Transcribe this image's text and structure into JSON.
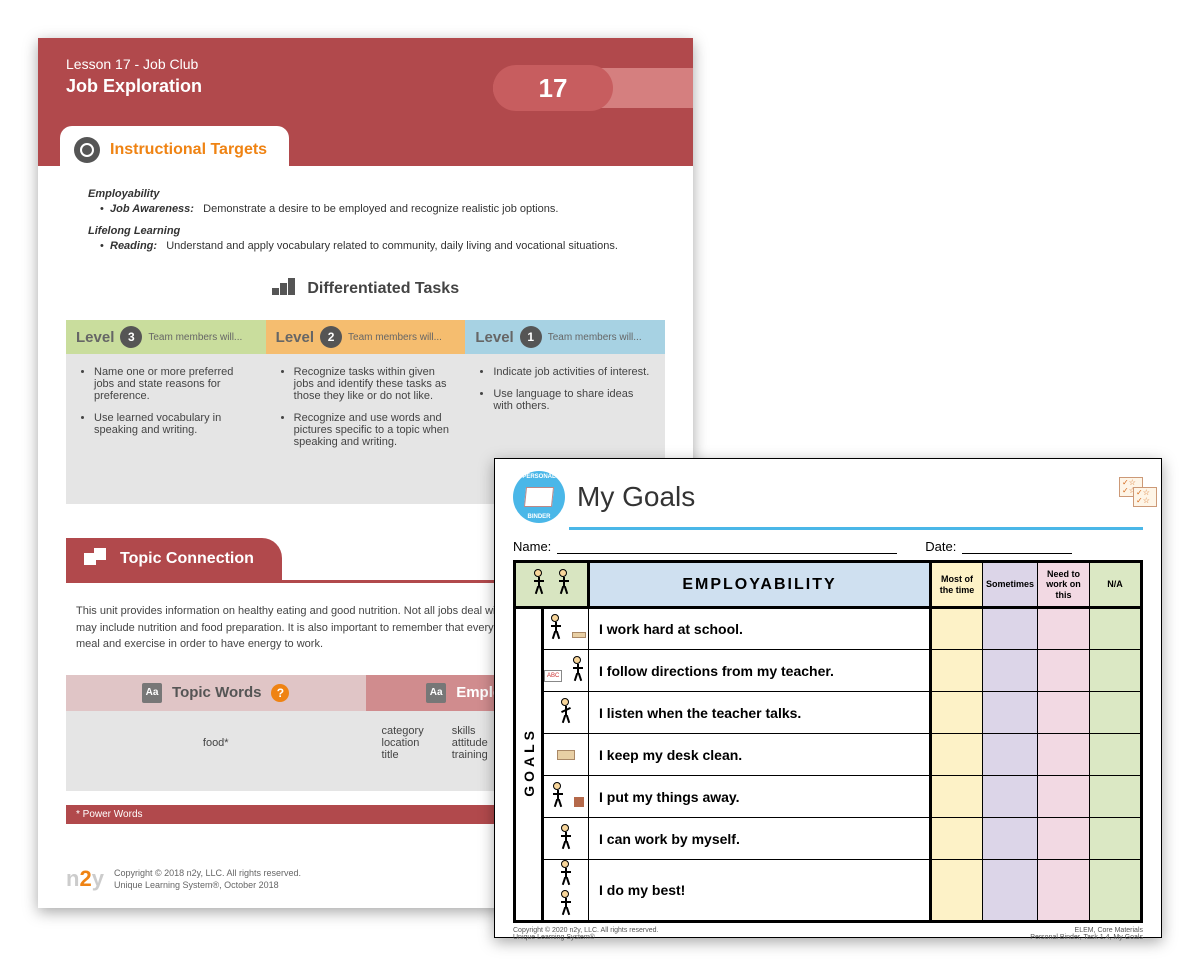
{
  "page1": {
    "lesson_line": "Lesson 17 - Job Club",
    "title": "Job Exploration",
    "number": "17",
    "tab_label": "Instructional Targets",
    "targets": {
      "cat1": "Employability",
      "cat1_bullet_label": "Job Awareness:",
      "cat1_bullet_text": "Demonstrate a desire to be employed and recognize realistic job options.",
      "cat2": "Lifelong Learning",
      "cat2_bullet_label": "Reading:",
      "cat2_bullet_text": "Understand and apply vocabulary related to community, daily living and vocational situations."
    },
    "diff_heading": "Differentiated Tasks",
    "levels": [
      {
        "name": "Level",
        "num": "3",
        "hint": "Team members will...",
        "items": [
          "Name one or more preferred jobs and state reasons for preference.",
          "Use learned vocabulary in speaking and writing."
        ]
      },
      {
        "name": "Level",
        "num": "2",
        "hint": "Team members will...",
        "items": [
          "Recognize tasks within given jobs and identify these tasks as those they like or do not like.",
          "Recognize and use words and pictures specific to a topic when speaking and writing."
        ]
      },
      {
        "name": "Level",
        "num": "1",
        "hint": "Team members will...",
        "items": [
          "Indicate job activities of interest.",
          "Use language to share ideas with others."
        ]
      }
    ],
    "topic_tab": "Topic Connection",
    "topic_body": "This unit provides information on healthy eating and good nutrition. Not all jobs deal with food preparation, but some may include nutrition and food preparation. It is also important to remember that everyone needs to eat a balanced meal and exercise in order to have energy to work.",
    "words": {
      "col1_head": "Topic Words",
      "col1_word": "food*",
      "col2_head": "Employability Words",
      "col2_a": [
        "category",
        "location",
        "title"
      ],
      "col2_b": [
        "skills",
        "attitude",
        "training"
      ]
    },
    "power_words": "* Power Words",
    "footer_line1": "Copyright © 2018 n2y, LLC. All rights reserved.",
    "footer_line2": "Unique Learning System®, October 2018"
  },
  "page2": {
    "badge_top": "PERSONAL",
    "badge_bottom": "BINDER",
    "title": "My Goals",
    "name_label": "Name:",
    "date_label": "Date:",
    "header_employability": "EMPLOYABILITY",
    "cols": [
      "Most of the time",
      "Sometimes",
      "Need to work on this",
      "N/A"
    ],
    "goals_side": "GOALS",
    "rows": [
      "I work hard at school.",
      "I follow directions from my teacher.",
      "I listen when the teacher talks.",
      "I keep my desk clean.",
      "I put my things away.",
      "I can work by myself.",
      "I do my best!"
    ],
    "footer_left1": "Copyright © 2020 n2y, LLC. All rights reserved.",
    "footer_left2": "Unique Learning System®",
    "footer_right1": "ELEM, Core Materials",
    "footer_right2": "Personal Binder, Task 1.4, My Goals"
  }
}
